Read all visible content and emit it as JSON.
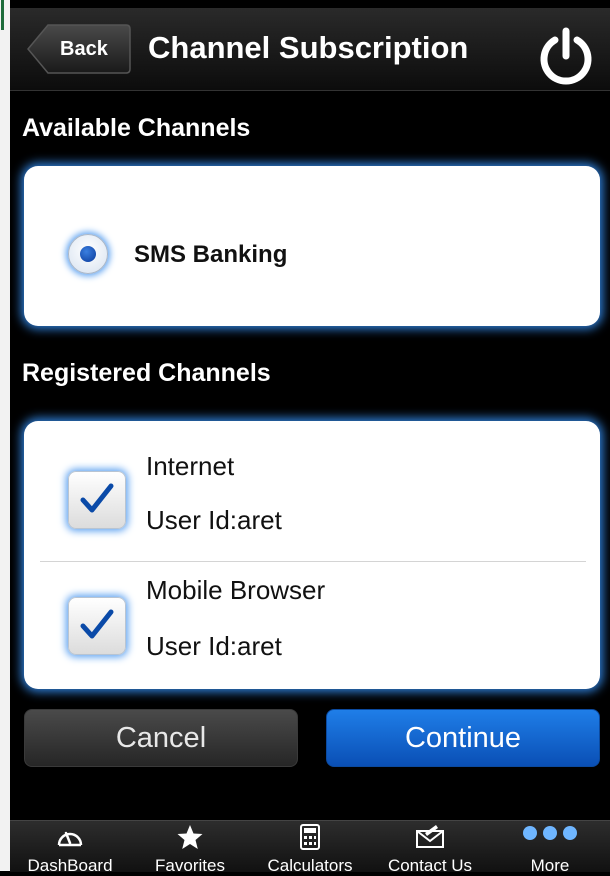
{
  "header": {
    "back_label": "Back",
    "title": "Channel Subscription",
    "power_icon": "power-icon"
  },
  "available": {
    "title": "Available Channels",
    "options": [
      {
        "label": "SMS Banking",
        "selected": true
      }
    ]
  },
  "registered": {
    "title": "Registered Channels",
    "channels": [
      {
        "name": "Internet",
        "user": "User Id:aret",
        "checked": true
      },
      {
        "name": "Mobile Browser",
        "user": "User Id:aret",
        "checked": true
      }
    ]
  },
  "actions": {
    "cancel_label": "Cancel",
    "continue_label": "Continue"
  },
  "tabs": [
    {
      "label": "DashBoard",
      "icon": "dashboard-gauge-icon"
    },
    {
      "label": "Favorites",
      "icon": "star-icon"
    },
    {
      "label": "Calculators",
      "icon": "calculator-icon"
    },
    {
      "label": "Contact Us",
      "icon": "envelope-icon"
    },
    {
      "label": "More",
      "icon": "more-dots-icon"
    }
  ],
  "colors": {
    "accent_blue": "#0a4fb5",
    "glow_blue": "#2f7fd8",
    "background": "#000000"
  }
}
